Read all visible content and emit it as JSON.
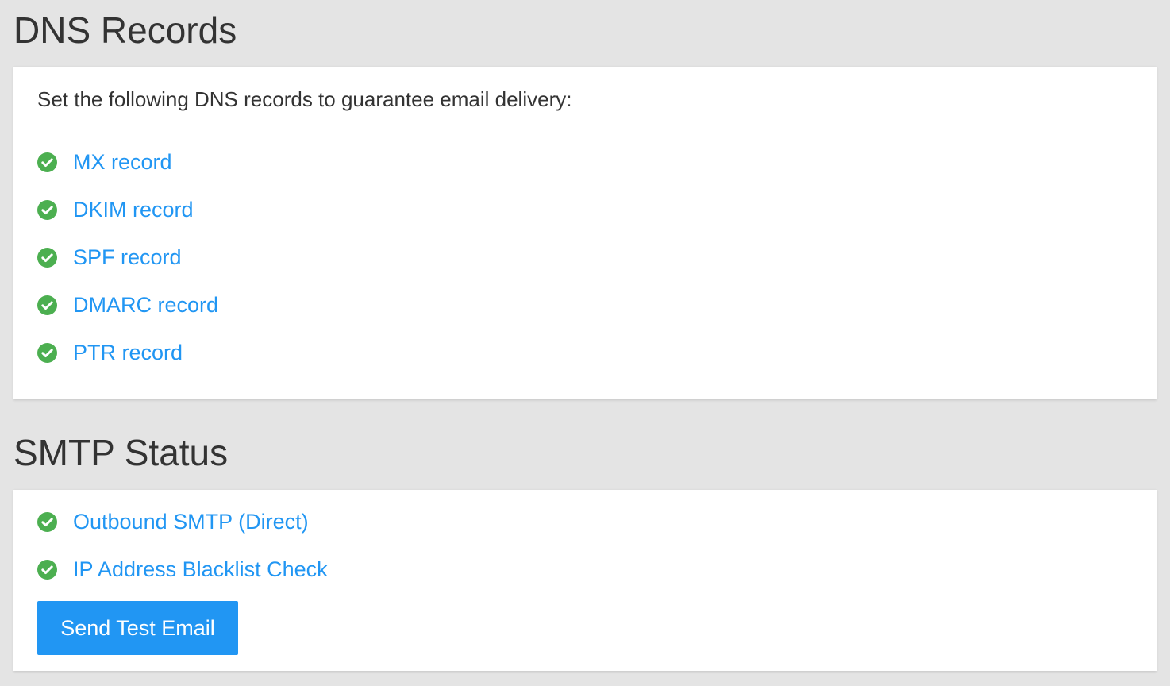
{
  "dns_section": {
    "title": "DNS Records",
    "intro": "Set the following DNS records to guarantee email delivery:",
    "records": [
      {
        "label": "MX record",
        "status": "ok",
        "icon": "check-circle-icon"
      },
      {
        "label": "DKIM record",
        "status": "ok",
        "icon": "check-circle-icon"
      },
      {
        "label": "SPF record",
        "status": "ok",
        "icon": "check-circle-icon"
      },
      {
        "label": "DMARC record",
        "status": "ok",
        "icon": "check-circle-icon"
      },
      {
        "label": "PTR record",
        "status": "ok",
        "icon": "check-circle-icon"
      }
    ]
  },
  "smtp_section": {
    "title": "SMTP Status",
    "checks": [
      {
        "label": "Outbound SMTP (Direct)",
        "status": "ok",
        "icon": "check-circle-icon"
      },
      {
        "label": "IP Address Blacklist Check",
        "status": "ok",
        "icon": "check-circle-icon"
      }
    ],
    "button_label": "Send Test Email"
  },
  "colors": {
    "background": "#e4e4e4",
    "card": "#ffffff",
    "link": "#2196f3",
    "success": "#4caf50",
    "button": "#2196f3",
    "text": "#333333"
  }
}
